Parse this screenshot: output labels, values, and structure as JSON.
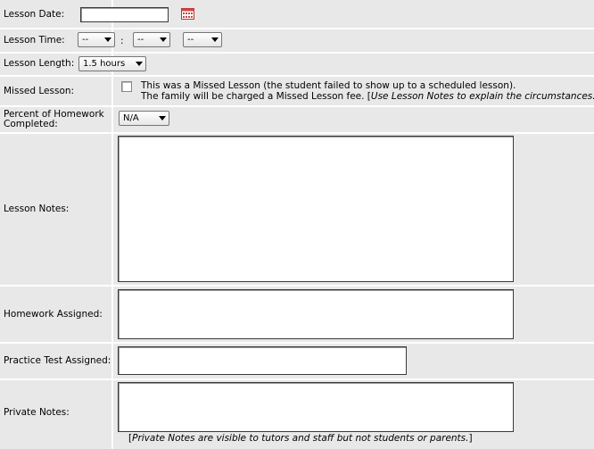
{
  "lesson_date": {
    "label": "Lesson Date:",
    "value": ""
  },
  "lesson_time": {
    "label": "Lesson Time:",
    "hour": "--",
    "separator": ":",
    "minute": "--",
    "ampm": "--"
  },
  "lesson_length": {
    "label": "Lesson Length:",
    "value": "1.5 hours"
  },
  "missed_lesson": {
    "label": "Missed Lesson:",
    "text_line1": "This was a Missed Lesson (the student failed to show up to a scheduled lesson).",
    "text_line2_prefix": "The family will be charged a Missed Lesson fee. [",
    "text_line2_italic": "Use Lesson Notes to explain the circumstances.",
    "text_line2_suffix": "]"
  },
  "homework_percent": {
    "label_line1": "Percent of Homework",
    "label_line2": "Completed:",
    "value": "N/A"
  },
  "lesson_notes": {
    "label": "Lesson Notes:",
    "value": ""
  },
  "homework_assigned": {
    "label": "Homework Assigned:",
    "value": ""
  },
  "practice_test": {
    "label": "Practice Test Assigned:",
    "value": ""
  },
  "private_notes": {
    "label": "Private Notes:",
    "value": "",
    "hint_prefix": "[",
    "hint_italic": "Private Notes are visible to tutors and staff but not students or parents.",
    "hint_suffix": "]"
  },
  "icons": {
    "calendar": "calendar-icon"
  }
}
